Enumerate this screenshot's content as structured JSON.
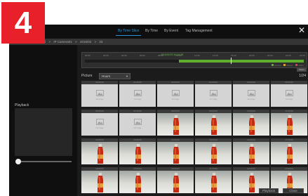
{
  "step_badge": "4",
  "nav": {
    "tabs": [
      {
        "label": "By Time Slice",
        "active": true
      },
      {
        "label": "By Time",
        "active": false
      },
      {
        "label": "By Event",
        "active": false
      },
      {
        "label": "Tag Management",
        "active": false
      }
    ],
    "close_icon": "close-icon"
  },
  "breadcrumb": {
    "items": [
      "Camera Thumbnail",
      ">",
      "IP Camera01",
      ">",
      "2016/02",
      ">",
      "23"
    ]
  },
  "left_panel": {
    "playback_label": "Playback"
  },
  "timeline": {
    "ticks": [
      "00:00",
      "02:00",
      "04:00",
      "06:00",
      "08:00",
      "10:00",
      "12:00",
      "14:00",
      "16:00",
      "18:00",
      "20:00",
      "22:00",
      "24:00"
    ],
    "current_time": "2016/02/23 16:04:28",
    "legend": [
      "Normal",
      "Motion",
      "Alarm"
    ],
    "zoom_label": "Zoom"
  },
  "filter": {
    "label": "Picture",
    "selected": "Hours",
    "page_count": "1/24"
  },
  "thumbnails": {
    "no_image_text": "No Image",
    "captions": [
      "00:00:00",
      "01:00:00",
      "02:00:00",
      "03:00:00",
      "04:00:00",
      "05:00:00",
      "06:00:00",
      "07:00:00",
      "08:00:00",
      "09:00:00",
      "10:00:00",
      "11:00:00",
      "12:00:00",
      "13:00:00",
      "14:00:00",
      "15:00:00",
      "16:00:00",
      "17:00:00",
      "18:00:00",
      "19:00:00",
      "20:00:00",
      "21:00:00",
      "22:00:00",
      "23:00:00"
    ],
    "states": [
      "empty",
      "empty",
      "empty",
      "empty",
      "empty",
      "empty",
      "empty",
      "empty",
      "photo",
      "photo",
      "photo",
      "photo",
      "photo",
      "photo",
      "photo",
      "photo",
      "photo",
      "photo",
      "photo",
      "photo",
      "photo",
      "photo",
      "photo",
      "photo"
    ]
  },
  "buttons": {
    "playback": "Playback",
    "close": "Close"
  },
  "colors": {
    "accent": "#2b92d8",
    "badge": "#e8202a",
    "record_green": "#5fae2e"
  }
}
